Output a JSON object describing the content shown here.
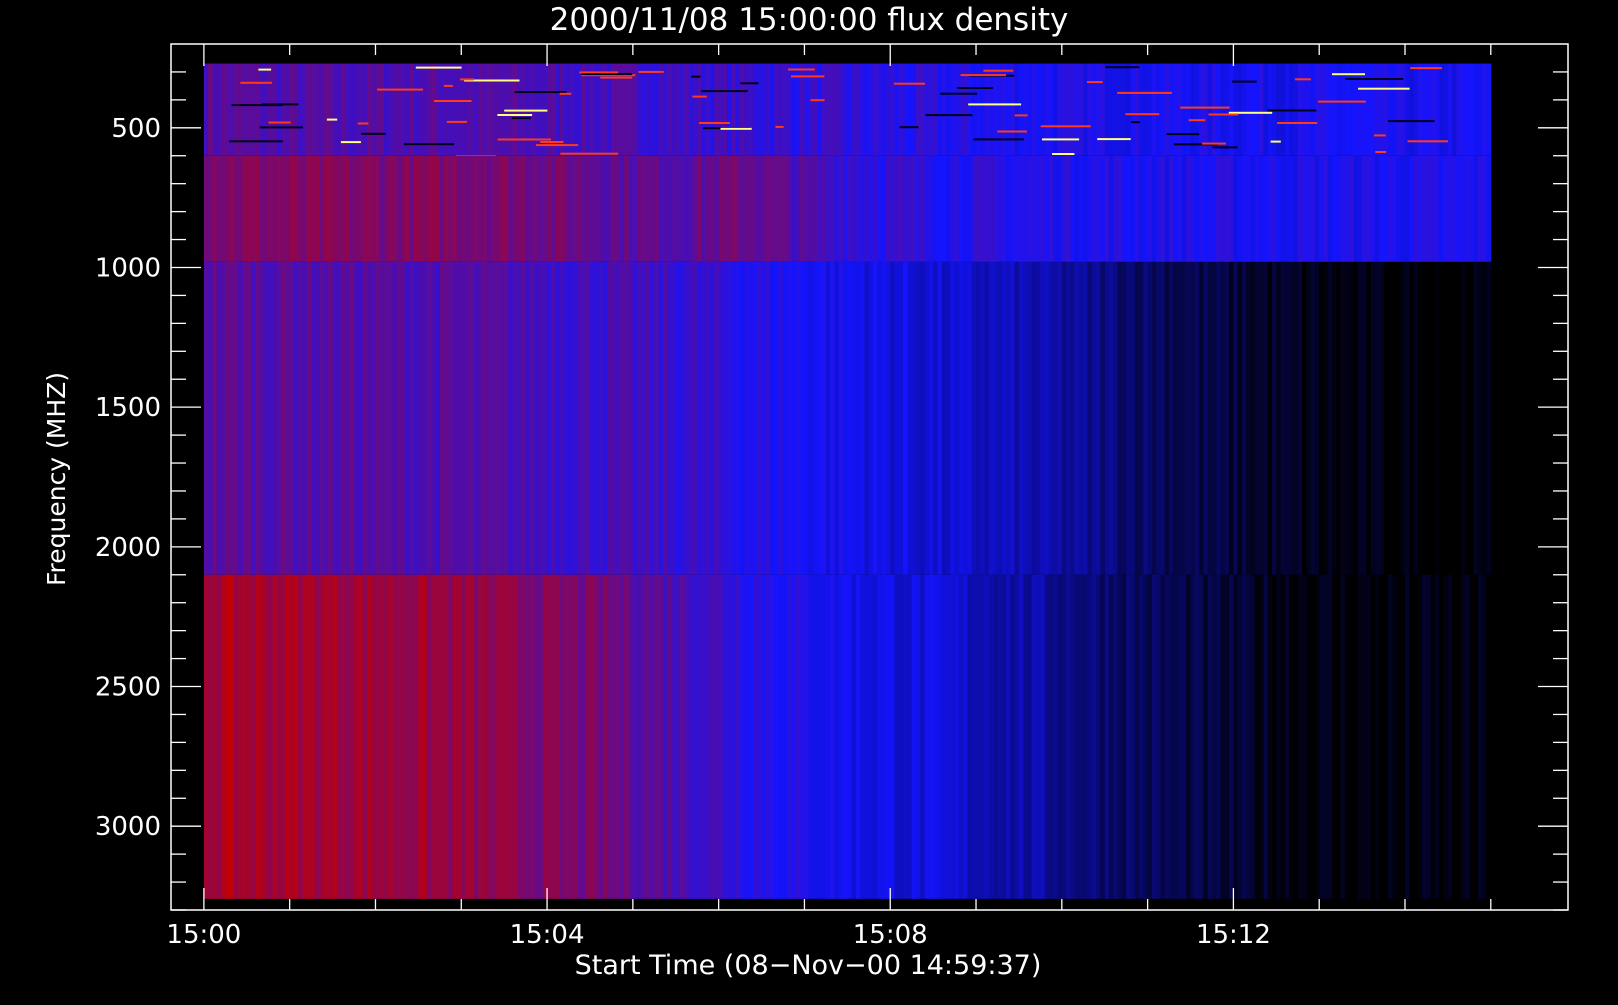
{
  "chart_data": {
    "type": "heatmap",
    "title": "2000/11/08 15:00:00 flux density",
    "xlabel": "Start Time (08−Nov−00 14:59:37)",
    "ylabel": "Frequency (MHZ)",
    "x_unit": "time",
    "x_range": [
      "14:59:37",
      "15:15:54"
    ],
    "data_time_range": [
      "15:00:00",
      "15:15:00"
    ],
    "x_major_ticks": [
      "15:00",
      "15:04",
      "15:08",
      "15:12"
    ],
    "x_minor_tick_interval_min": 1,
    "y_range": [
      200,
      3300
    ],
    "y_axis_inverted": true,
    "y_ticks": [
      500,
      1000,
      1500,
      2000,
      2500,
      3000
    ],
    "y_minor_tick_interval": 100,
    "data_freq_range": [
      270,
      3260
    ],
    "colors": {
      "background": "#000000",
      "axes": "#ffffff",
      "low": "#000000",
      "mid": "#1414ff",
      "high": "#c40000"
    },
    "bands": [
      {
        "name": "band-1",
        "freq_range": [
          270,
          600
        ],
        "intensity": [
          0.7,
          0.66,
          0.66,
          0.67,
          0.66,
          0.65,
          0.64,
          0.62,
          0.6,
          0.58,
          0.55,
          0.53,
          0.52,
          0.51,
          0.5,
          0.5,
          0.49,
          0.49,
          0.48,
          0.48
        ]
      },
      {
        "name": "band-2",
        "freq_range": [
          600,
          980
        ],
        "intensity": [
          0.82,
          0.8,
          0.79,
          0.8,
          0.8,
          0.77,
          0.72,
          0.7,
          0.75,
          0.64,
          0.58,
          0.55,
          0.54,
          0.53,
          0.52,
          0.52,
          0.51,
          0.51,
          0.51,
          0.51
        ]
      },
      {
        "name": "band-3",
        "freq_range": [
          980,
          2100
        ],
        "intensity": [
          0.7,
          0.69,
          0.68,
          0.67,
          0.66,
          0.64,
          0.62,
          0.6,
          0.55,
          0.5,
          0.45,
          0.4,
          0.35,
          0.28,
          0.2,
          0.12,
          0.06,
          0.02,
          0.01,
          0.0
        ]
      },
      {
        "name": "band-4",
        "freq_range": [
          2100,
          3260
        ],
        "intensity": [
          0.92,
          0.91,
          0.9,
          0.88,
          0.85,
          0.8,
          0.75,
          0.67,
          0.58,
          0.5,
          0.45,
          0.4,
          0.33,
          0.25,
          0.17,
          0.1,
          0.05,
          0.02,
          0.02,
          0.01
        ]
      }
    ]
  }
}
